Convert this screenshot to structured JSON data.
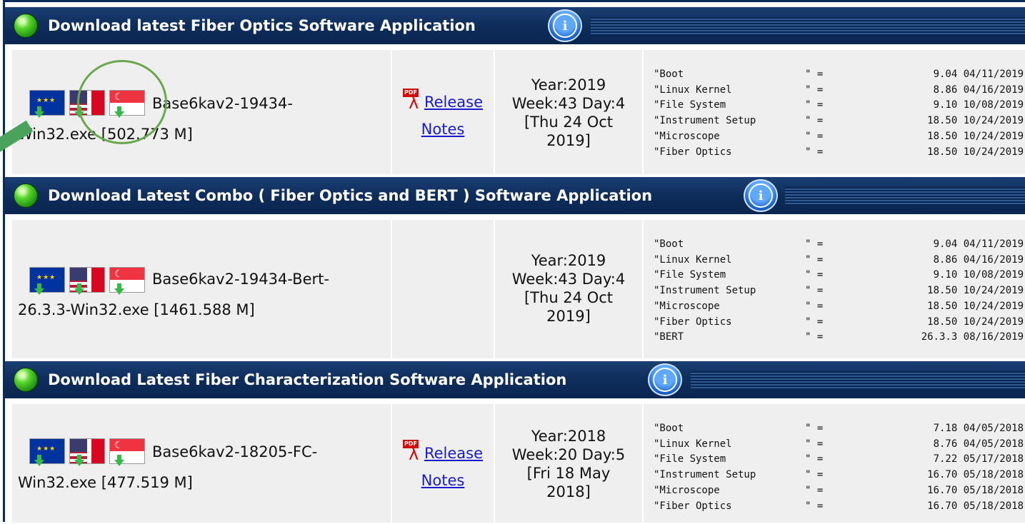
{
  "sections": [
    {
      "title": "Download latest Fiber Optics Software Application",
      "file": "Base6kav2-19434-Win32.exe [502.773 M]",
      "file_lines": [
        "Base6kav2-19434-",
        "Win32.exe [502.773 M]"
      ],
      "release_notes": [
        "Release",
        "Notes"
      ],
      "date_lines": [
        "Year:2019",
        "Week:43 Day:4",
        "[Thu 24 Oct",
        "2019]"
      ],
      "versions": [
        {
          "name": "\"Boot",
          "eq": "\" =",
          "value": "9.04 04/11/2019"
        },
        {
          "name": "\"Linux Kernel",
          "eq": "\" =",
          "value": "8.86 04/16/2019"
        },
        {
          "name": "\"File System",
          "eq": "\" =",
          "value": "9.10 10/08/2019"
        },
        {
          "name": "\"Instrument Setup",
          "eq": "\" =",
          "value": "18.50 10/24/2019"
        },
        {
          "name": "\"Microscope",
          "eq": "\" =",
          "value": "18.50 10/24/2019"
        },
        {
          "name": "\"Fiber Optics",
          "eq": "\" =",
          "value": "18.50 10/24/2019"
        }
      ]
    },
    {
      "title": "Download Latest Combo ( Fiber Optics and BERT ) Software Application",
      "file_lines": [
        "Base6kav2-19434-Bert-",
        "26.3.3-Win32.exe [1461.588 M]"
      ],
      "date_lines": [
        "Year:2019",
        "Week:43 Day:4",
        "[Thu 24 Oct",
        "2019]"
      ],
      "versions": [
        {
          "name": "\"Boot",
          "eq": "\" =",
          "value": "9.04 04/11/2019"
        },
        {
          "name": "\"Linux Kernel",
          "eq": "\" =",
          "value": "8.86 04/16/2019"
        },
        {
          "name": "\"File System",
          "eq": "\" =",
          "value": "9.10 10/08/2019"
        },
        {
          "name": "\"Instrument Setup",
          "eq": "\" =",
          "value": "18.50 10/24/2019"
        },
        {
          "name": "\"Microscope",
          "eq": "\" =",
          "value": "18.50 10/24/2019"
        },
        {
          "name": "\"Fiber Optics",
          "eq": "\" =",
          "value": "18.50 10/24/2019"
        },
        {
          "name": "\"BERT",
          "eq": "\" =",
          "value": "26.3.3 08/16/2019"
        }
      ]
    },
    {
      "title": "Download Latest Fiber Characterization Software Application",
      "file_lines": [
        "Base6kav2-18205-FC-",
        "Win32.exe [477.519 M]"
      ],
      "release_notes": [
        "Release",
        "Notes"
      ],
      "date_lines": [
        "Year:2018",
        "Week:20 Day:5",
        "[Fri 18 May",
        "2018]"
      ],
      "versions": [
        {
          "name": "\"Boot",
          "eq": "\" =",
          "value": "7.18 04/05/2018"
        },
        {
          "name": "\"Linux Kernel",
          "eq": "\" =",
          "value": "8.76 04/05/2018"
        },
        {
          "name": "\"File System",
          "eq": "\" =",
          "value": "7.22 05/17/2018"
        },
        {
          "name": "\"Instrument Setup",
          "eq": "\" =",
          "value": "16.70 05/18/2018"
        },
        {
          "name": "\"Microscope",
          "eq": "\" =",
          "value": "16.70 05/18/2018"
        },
        {
          "name": "\"Fiber Optics",
          "eq": "\" =",
          "value": "16.70 05/18/2018"
        }
      ]
    }
  ],
  "icons": {
    "status": "green-dot-icon",
    "info": "info-icon",
    "pdf": "pdf-icon",
    "flags": [
      "eu-flag-icon",
      "us-canada-flag-icon",
      "singapore-flag-icon"
    ]
  },
  "info_glyph": "i",
  "colors": {
    "header_bg": "#0f2e5c",
    "row_bg": "#efefef",
    "link": "#1a1acd",
    "highlight": "#6aa84f"
  }
}
